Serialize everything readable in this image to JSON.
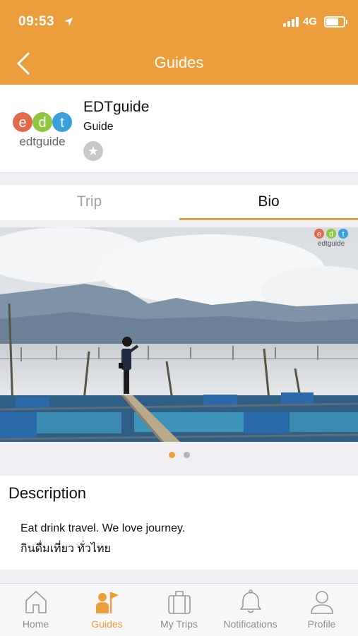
{
  "status_bar": {
    "time": "09:53",
    "network": "4G"
  },
  "header": {
    "title": "Guides"
  },
  "profile": {
    "name": "EDTguide",
    "role": "Guide",
    "logo_letters": [
      "e",
      "d",
      "t"
    ],
    "logo_text": "edtguide"
  },
  "tabs": {
    "trip": "Trip",
    "bio": "Bio",
    "active": "Bio"
  },
  "carousel": {
    "watermark_letters": [
      "e",
      "d",
      "t"
    ],
    "watermark_text": "edtguide",
    "page_count": 2,
    "current_page": 1
  },
  "description": {
    "title": "Description",
    "line1": "Eat drink travel. We love journey.",
    "line2": "กินดื่มเที่ยว ทั่วไทย"
  },
  "tab_bar": {
    "items": [
      "Home",
      "Guides",
      "My Trips",
      "Notifications",
      "Profile"
    ],
    "active": "Guides"
  },
  "colors": {
    "accent": "#eb9e3b",
    "logo_e": "#e26a4b",
    "logo_d": "#8dc63f",
    "logo_t": "#3aa0db"
  }
}
